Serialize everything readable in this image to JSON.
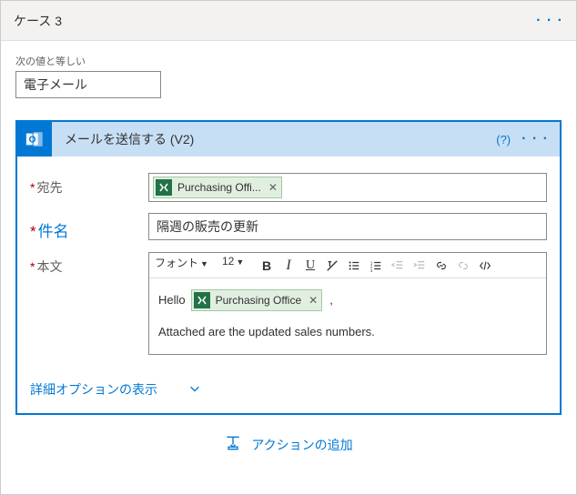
{
  "case": {
    "title": "ケース 3"
  },
  "condition": {
    "label": "次の値と等しい",
    "value": "電子メール"
  },
  "action": {
    "title": "メールを送信する (V2)",
    "help": "(?)"
  },
  "fields": {
    "to_label": "宛先",
    "to_token": "Purchasing Offi...",
    "subject_label": "件名",
    "subject_value": "隔週の販売の更新",
    "body_label": "本文"
  },
  "rte": {
    "font_label": "フォント",
    "size_label": "12",
    "hello": "Hello",
    "token": "Purchasing Office",
    "comma": ",",
    "line2": "Attached are the updated sales numbers."
  },
  "advanced": {
    "label": "詳細オプションの表示"
  },
  "footer": {
    "add_action": "アクションの追加"
  }
}
